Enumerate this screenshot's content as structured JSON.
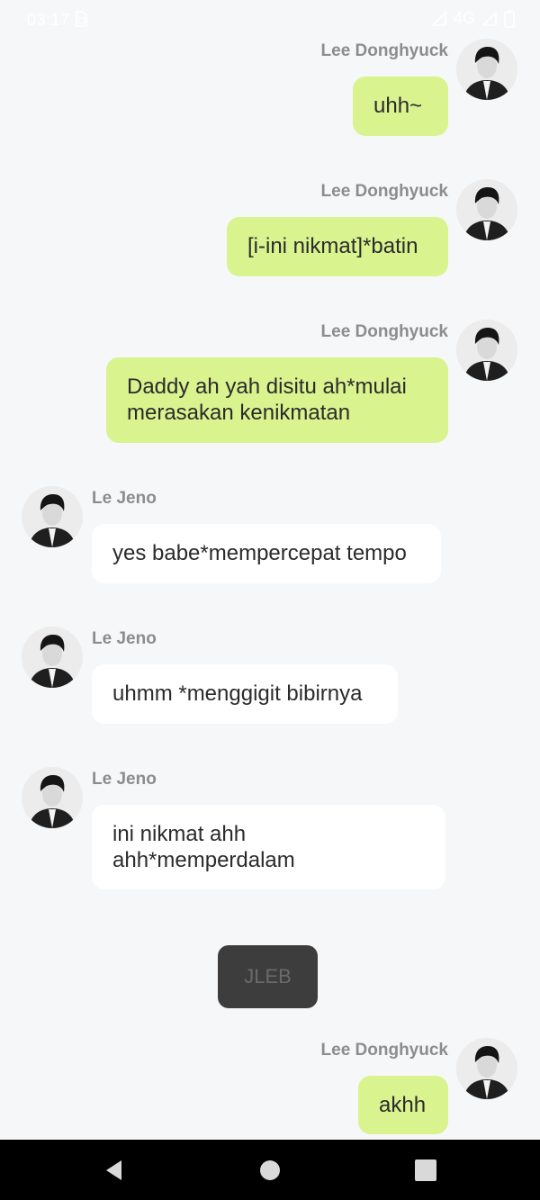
{
  "status_bar": {
    "time": "03:17",
    "network": "4G",
    "icons": [
      "sim-card-icon",
      "signal-icon",
      "signal-icon",
      "battery-icon"
    ]
  },
  "messages": [
    {
      "side": "right",
      "sender": "Lee Donghyuck",
      "text": "uhh~"
    },
    {
      "side": "right",
      "sender": "Lee Donghyuck",
      "text": "[i-ini nikmat]*batin"
    },
    {
      "side": "right",
      "sender": "Lee Donghyuck",
      "text": "Daddy ah yah disitu ah*mulai merasakan kenikmatan"
    },
    {
      "side": "left",
      "sender": "Le Jeno",
      "text": "yes babe*mempercepat tempo"
    },
    {
      "side": "left",
      "sender": "Le Jeno",
      "text": "uhmm *menggigit bibirnya"
    },
    {
      "side": "left",
      "sender": "Le Jeno",
      "text": "ini nikmat ahh ahh*memperdalam"
    },
    {
      "side": "right",
      "sender": "Lee Donghyuck",
      "text": "akhh"
    }
  ],
  "system_message": "JLEB",
  "nav_bar": {
    "icons": [
      "back-icon",
      "home-icon",
      "recents-icon"
    ]
  },
  "colors": {
    "background": "#f6f7f9",
    "right_bubble": "#d9f38f",
    "left_bubble": "#ffffff",
    "sender_name": "#8c8c8c",
    "system_pill": "#3d3d3d"
  }
}
